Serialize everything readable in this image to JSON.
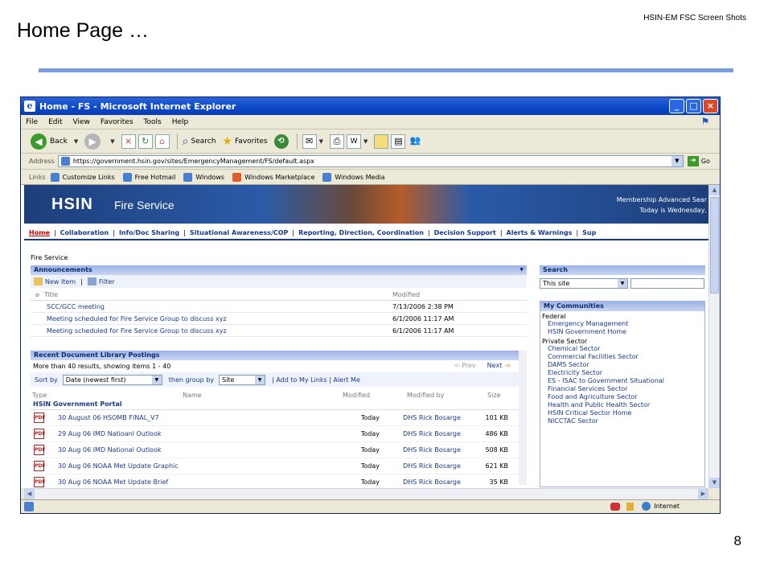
{
  "slide": {
    "title": "Home Page …",
    "header_note": "HSIN-EM FSC Screen Shots",
    "page_number": "8"
  },
  "window": {
    "title": "Home - FS - Microsoft Internet Explorer",
    "controls": {
      "minimize": "_",
      "maximize": "□",
      "close": "×"
    }
  },
  "menu": [
    "File",
    "Edit",
    "View",
    "Favorites",
    "Tools",
    "Help"
  ],
  "toolbar": {
    "back": "Back",
    "search": "Search",
    "favorites": "Favorites"
  },
  "address": {
    "label": "Address",
    "url": "https://government.hsin.gov/sites/EmergencyManagement/FS/default.aspx",
    "go": "Go"
  },
  "links": {
    "label": "Links",
    "items": [
      "Customize Links",
      "Free Hotmail",
      "Windows",
      "Windows Marketplace",
      "Windows Media"
    ]
  },
  "banner": {
    "brand": "HSIN",
    "site": "Fire Service",
    "membership": "Membership   Advanced Sear",
    "today": "Today is Wednesday,"
  },
  "nav": [
    "Home",
    "Collaboration",
    "Info/Doc Sharing",
    "Situational Awareness/COP",
    "Reporting, Direction, Coordination",
    "Decision Support",
    "Alerts & Warnings",
    "Sup"
  ],
  "site_label": "Fire Service",
  "announcements": {
    "heading": "Announcements",
    "new_item": "New Item",
    "filter": "Filter",
    "col_title": "Title",
    "col_modified": "Modified",
    "rows": [
      {
        "title": "SCC/GCC meeting",
        "modified": "7/13/2006 2:38 PM"
      },
      {
        "title": "Meeting scheduled for Fire Service Group to discuss xyz",
        "modified": "6/1/2006 11:17 AM"
      },
      {
        "title": "Meeting scheduled for Fire Service Group to discuss xyz",
        "modified": "6/1/2006 11:17 AM"
      }
    ]
  },
  "documents": {
    "heading": "Recent Document Library Postings",
    "info": "More than 40 results, showing items 1 - 40",
    "prev": "Prev",
    "next": "Next",
    "sort_by": "Sort by",
    "sort_value": "Date (newest first)",
    "group_by": "then group by",
    "group_value": "Site",
    "actions": "| Add to My Links | Alert Me",
    "cols": {
      "type": "Type",
      "name": "Name",
      "modified": "Modified",
      "modified_by": "Modified by",
      "size": "Size"
    },
    "group": "HSIN Government Portal",
    "rows": [
      {
        "name": "30 August 06 HSOMB FINAL_V7",
        "modified": "Today",
        "by": "DHS Rick Bosarge",
        "size": "101 KB"
      },
      {
        "name": "29 Aug 06 IMD Natioanl Outlook",
        "modified": "Today",
        "by": "DHS Rick Bosarge",
        "size": "486 KB"
      },
      {
        "name": "30 Aug 06 IMD National Outlook",
        "modified": "Today",
        "by": "DHS Rick Bosarge",
        "size": "508 KB"
      },
      {
        "name": "30 Aug 06 NOAA Met Update Graphic",
        "modified": "Today",
        "by": "DHS Rick Bosarge",
        "size": "621 KB"
      },
      {
        "name": "30 Aug 06 NOAA Met Update Brief",
        "modified": "Today",
        "by": "DHS Rick Bosarge",
        "size": "35 KB"
      }
    ]
  },
  "search": {
    "heading": "Search",
    "scope": "This site"
  },
  "communities": {
    "heading": "My Communities",
    "federal_label": "Federal",
    "federal": [
      "Emergency Management",
      "HSIN Government Home"
    ],
    "private_label": "Private Sector",
    "private": [
      "Chemical Sector",
      "Commercial Facilities Sector",
      "DAMS Sector",
      "Electricity Sector",
      "ES - ISAC to Government Situational",
      "Financial Services Sector",
      "Food and Agriculture Sector",
      "Health and Public Health Sector",
      "HSIN Critical Sector Home",
      "NICCTAC Sector"
    ]
  },
  "status": {
    "zone": "Internet"
  }
}
